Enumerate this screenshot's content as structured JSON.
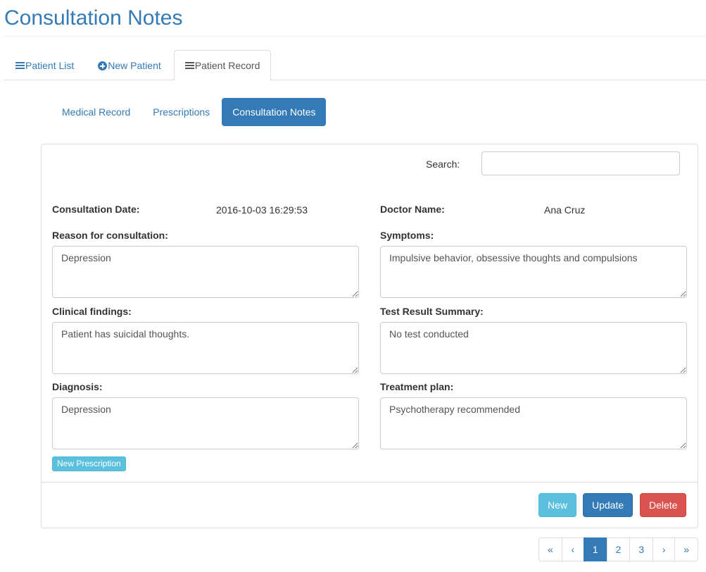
{
  "page": {
    "title": "Consultation Notes"
  },
  "main_tabs": [
    {
      "label": "Patient List",
      "icon": "list-icon"
    },
    {
      "label": "New Patient",
      "icon": "plus-circle-icon"
    },
    {
      "label": "Patient Record",
      "icon": "list-icon",
      "active": true
    }
  ],
  "sub_tabs": [
    {
      "label": "Medical Record"
    },
    {
      "label": "Prescriptions"
    },
    {
      "label": "Consultation Notes",
      "active": true
    }
  ],
  "search": {
    "label": "Search:",
    "value": ""
  },
  "consultation": {
    "date_label": "Consultation Date:",
    "date_value": "2016-10-03 16:29:53",
    "doctor_label": "Doctor Name:",
    "doctor_value": "Ana Cruz",
    "reason_label": "Reason for consultation:",
    "reason_value": "Depression",
    "symptoms_label": "Symptoms:",
    "symptoms_value": "Impulsive behavior, obsessive thoughts and compulsions",
    "findings_label": "Clinical findings:",
    "findings_value": "Patient has suicidal thoughts.",
    "test_label": "Test Result Summary:",
    "test_value": "No test conducted",
    "diagnosis_label": "Diagnosis:",
    "diagnosis_value": "Depression",
    "treatment_label": "Treatment plan:",
    "treatment_value": "Psychotherapy recommended"
  },
  "buttons": {
    "new_prescription": "New Prescription",
    "new": "New",
    "update": "Update",
    "delete": "Delete"
  },
  "pagination": {
    "first": "«",
    "prev": "‹",
    "pages": [
      "1",
      "2",
      "3"
    ],
    "active_page": "1",
    "next": "›",
    "last": "»"
  },
  "colors": {
    "primary": "#337ab7",
    "info": "#5bc0de",
    "danger": "#d9534f",
    "border": "#dddddd"
  }
}
